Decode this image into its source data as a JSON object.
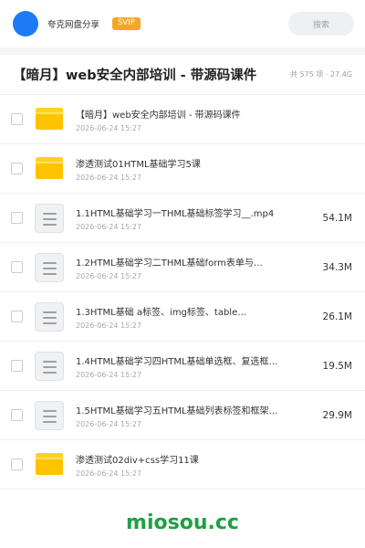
{
  "header": {
    "username": "夸克网盘分享",
    "badge": "SVIP",
    "search_placeholder": "搜索"
  },
  "share": {
    "title": "【暗月】web安全内部培训 - 带源码课件",
    "meta": "共 575 项 · 27.4G"
  },
  "files": [
    {
      "type": "folder",
      "name": "【暗月】web安全内部培训 - 带源码课件",
      "date": "2026-06-24 15:27",
      "size": ""
    },
    {
      "type": "folder",
      "name": "渗透测试01HTML基础学习5课",
      "date": "2026-06-24 15:27",
      "size": ""
    },
    {
      "type": "doc",
      "name": "1.1HTML基础学习一THML基础标签学习__.mp4",
      "date": "2026-06-24 15:27",
      "size": "54.1M"
    },
    {
      "type": "doc",
      "name": "1.2HTML基础学习二THML基础form表单与…",
      "date": "2026-06-24 15:27",
      "size": "34.3M"
    },
    {
      "type": "doc",
      "name": "1.3HTML基础 a标签、img标签、table…",
      "date": "2026-06-24 15:27",
      "size": "26.1M"
    },
    {
      "type": "doc",
      "name": "1.4HTML基础学习四HTML基础单选框、复选框…",
      "date": "2026-06-24 15:27",
      "size": "19.5M"
    },
    {
      "type": "doc",
      "name": "1.5HTML基础学习五HTML基础列表标签和框架…",
      "date": "2026-06-24 15:27",
      "size": "29.9M"
    },
    {
      "type": "folder",
      "name": "渗透测试02div+css学习11课",
      "date": "2026-06-24 15:27",
      "size": ""
    }
  ],
  "footer": {
    "brand": "miosou.cc"
  },
  "colors": {
    "accent": "#1e7bf6",
    "badge": "#f5a623",
    "folder": "#ffc300",
    "brand": "#1fa044"
  }
}
